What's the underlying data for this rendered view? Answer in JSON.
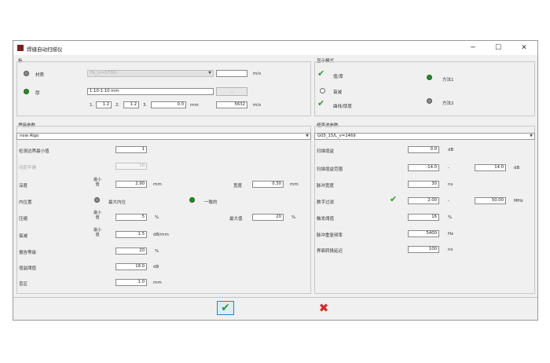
{
  "window": {
    "title": "焊缝自动扫描仪",
    "minimize": "─",
    "maximize": "☐",
    "close": "✕"
  },
  "material": {
    "group_label": "板",
    "material_label": "材质",
    "material_value": "Fe_(v=5730)",
    "velocity_unit": "m/s",
    "thickness_label": "厚",
    "thickness_value": "1.10-1.10 mm",
    "browse_label": "...",
    "n1_label": "1.",
    "n1": "1.2",
    "n2_label": "2.",
    "n2": "1.2",
    "n3_label": "3.",
    "n3": "0.0",
    "n_unit": "mm",
    "velocity_value": "5632",
    "velocity_unit2": "m/s"
  },
  "display_mode": {
    "group_label": "显示模式",
    "option1": "值/厚",
    "option2": "衰减",
    "option3": "曲线/厚度",
    "method1": "方法1",
    "method2": "方法2"
  },
  "weld_params": {
    "group_label": "焊接参数",
    "algo_value": "new Algo",
    "min_edge_label": "检测边界最小值",
    "min_edge_value": "1",
    "interval_label": "间距不确",
    "interval_value": "10",
    "depth_label": "深度",
    "depth_min_label": "最小值",
    "depth_min_value": "2.90",
    "depth_unit": "mm",
    "width_label": "宽度",
    "width_value": "0.30",
    "width_unit": "mm",
    "position_label": "内位置",
    "pos_option1": "最大内位",
    "pos_option2": "一致的",
    "compress_label": "压缩",
    "compress_min_label": "最小值",
    "compress_min_value": "5",
    "compress_unit": "%",
    "compress_max_label": "最大值",
    "compress_max_value": "20",
    "compress_max_unit": "%",
    "atten_label": "衰减",
    "atten_min_label": "最小值",
    "atten_value": "1.5",
    "atten_unit": "dB/mm",
    "ref_label": "报告等级",
    "ref_value": "20",
    "ref_unit": "%",
    "gain_label": "增益阈值",
    "gain_value": "18.0",
    "gain_unit": "dB",
    "dead_label": "盲区",
    "dead_value": "1.0",
    "dead_unit": "mm"
  },
  "ultrasonic_params": {
    "group_label": "超声波参数",
    "probe_value": "G05_15/L_v=1469",
    "scan_gain_label": "扫描增益",
    "scan_gain_value": "0.0",
    "scan_gain_unit": "dB",
    "scan_range_label": "扫描增益范围",
    "scan_range_from": "-14.0",
    "scan_range_dash": "-",
    "scan_range_to": "14.0",
    "scan_range_unit": "dB",
    "pulse_width_label": "脉冲宽度",
    "pulse_width_value": "30",
    "pulse_width_unit": "ns",
    "digital_filter_label": "数字过滤",
    "filter_from": "2.00",
    "filter_dash": "-",
    "filter_to": "50.00",
    "filter_unit": "MHz",
    "trigger_label": "触发阈值",
    "trigger_value": "16",
    "trigger_unit": "%",
    "prf_label": "脉冲重复频率",
    "prf_value": "5400",
    "prf_unit": "Hz",
    "interface_label": "界面转换延迟",
    "interface_value": "100",
    "interface_unit": "ns"
  },
  "footer": {
    "ok_icon": "✔",
    "cancel_icon": "✖"
  }
}
